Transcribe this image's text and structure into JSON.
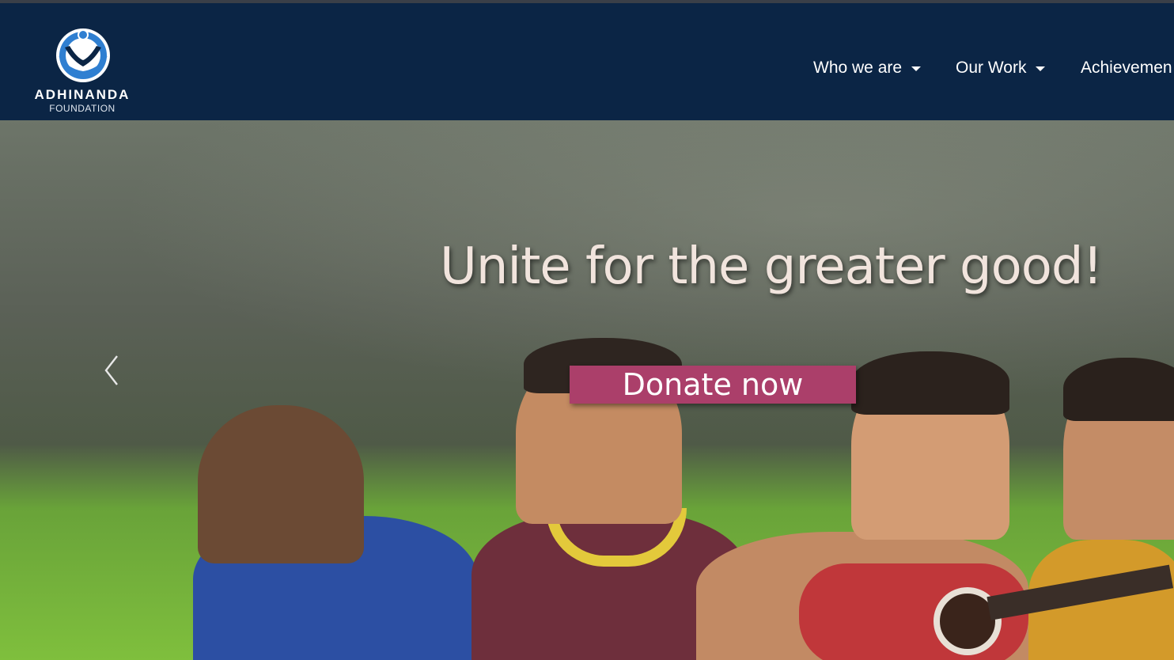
{
  "brand": {
    "name": "ADHINANDA",
    "subtitle": "FOUNDATION",
    "colors": {
      "navy": "#0b2545",
      "logo_blue": "#2f7fd1"
    }
  },
  "nav": {
    "items": [
      {
        "label": "Who we are",
        "dropdown": true
      },
      {
        "label": "Our Work",
        "dropdown": true
      },
      {
        "label": "Achievemen",
        "dropdown": false
      }
    ]
  },
  "hero": {
    "headline": "Unite for the greater good!",
    "cta_label": "Donate now",
    "cta_color": "#ab3f6a",
    "prev_icon": "chevron-left-icon"
  }
}
